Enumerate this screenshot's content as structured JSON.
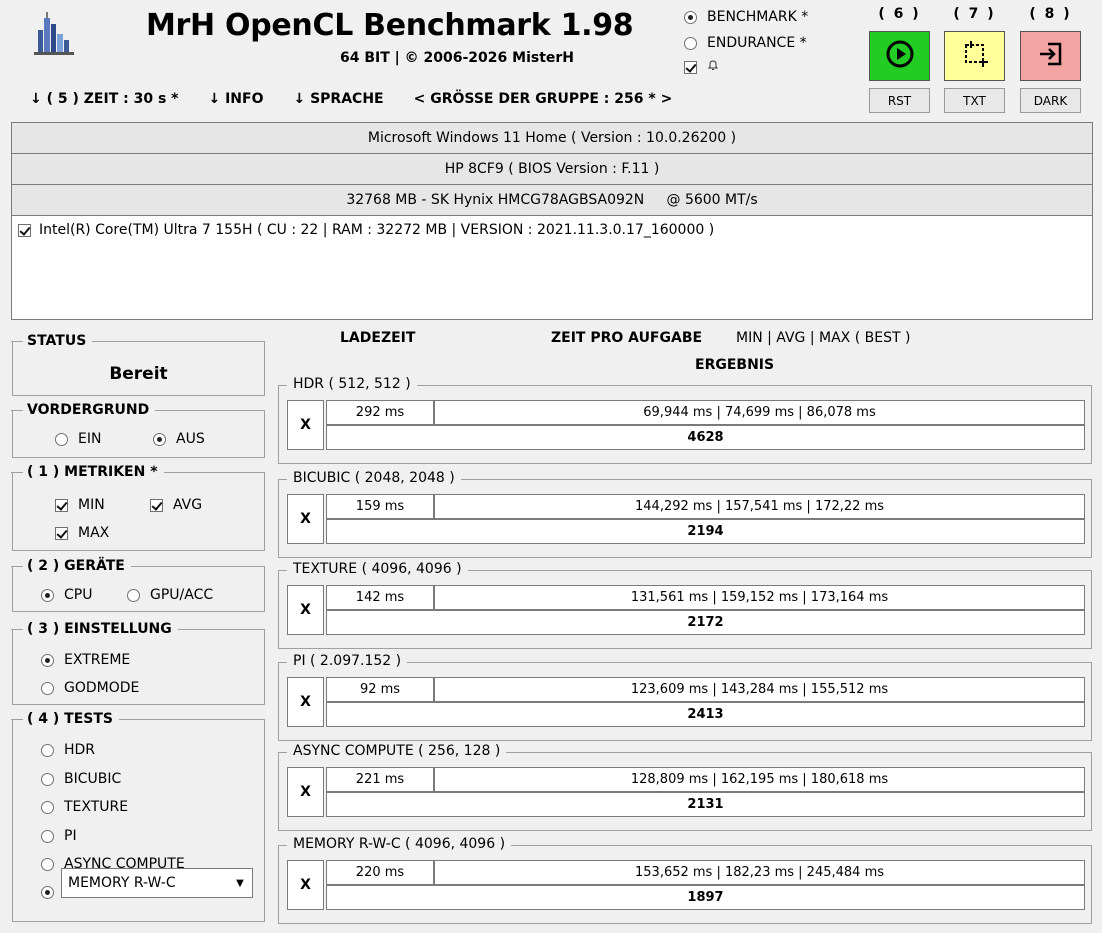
{
  "header": {
    "title": "MrH OpenCL Benchmark 1.98",
    "subtitle": "64 BIT | ©  2006-2026 MisterH",
    "logo_icon": "bar-building-logo-icon"
  },
  "top_nav": {
    "zeit": "↓ ( 5 ) ZEIT : 30 s *",
    "info": "↓ INFO",
    "sprache": "↓ SPRACHE",
    "gruppe": "< GRÖSSE DER GRUPPE : 256 * >"
  },
  "mode": {
    "benchmark": "BENCHMARK *",
    "endurance": "ENDURANCE *",
    "bell_icon": "bell-icon"
  },
  "actions": {
    "start_num": "( 6 )",
    "screenshot_num": "( 7 )",
    "exit_num": "( 8 )",
    "rst": "RST",
    "txt": "TXT",
    "dark": "DARK",
    "start_color": "#22cc22",
    "screenshot_color": "#ffff99",
    "exit_color": "#f4a3a3"
  },
  "system": {
    "os": "Microsoft Windows 11 Home ( Version : 10.0.26200 )",
    "board": "HP 8CF9 ( BIOS Version : F.11 )",
    "memory": "32768 MB - SK Hynix HMCG78AGBSA092N     @ 5600 MT/s",
    "device": "Intel(R) Core(TM) Ultra 7 155H ( CU : 22 | RAM : 32272 MB | VERSION : 2021.11.3.0.17_160000 )"
  },
  "status": {
    "title": "STATUS",
    "value": "Bereit"
  },
  "vordergrund": {
    "title": "VORDERGRUND",
    "ein": "EIN",
    "aus": "AUS"
  },
  "metriken": {
    "title": "( 1 ) METRIKEN *",
    "min": "MIN",
    "avg": "AVG",
    "max": "MAX"
  },
  "geraete": {
    "title": "( 2 ) GERÄTE",
    "cpu": "CPU",
    "gpu": "GPU/ACC"
  },
  "einstellung": {
    "title": "( 3 ) EINSTELLUNG",
    "extreme": "EXTREME",
    "godmode": "GODMODE"
  },
  "tests": {
    "title": "( 4 ) TESTS",
    "hdr": "HDR",
    "bicubic": "BICUBIC",
    "texture": "TEXTURE",
    "pi": "PI",
    "async": "ASYNC COMPUTE",
    "selected": "MEMORY R-W-C"
  },
  "columns": {
    "ladezeit": "LADEZEIT",
    "zeit_pro_aufgabe": "ZEIT PRO AUFGABE",
    "minavgmax": "MIN | AVG | MAX ( BEST )",
    "ergebnis": "ERGEBNIS"
  },
  "results": [
    {
      "name": "HDR ( 512, 512 )",
      "x": "X",
      "load": "292 ms",
      "times": "69,944 ms | 74,699 ms | 86,078 ms",
      "score": "4628"
    },
    {
      "name": "BICUBIC ( 2048, 2048 )",
      "x": "X",
      "load": "159 ms",
      "times": "144,292 ms | 157,541 ms | 172,22 ms",
      "score": "2194"
    },
    {
      "name": "TEXTURE ( 4096, 4096 )",
      "x": "X",
      "load": "142 ms",
      "times": "131,561 ms | 159,152 ms | 173,164 ms",
      "score": "2172"
    },
    {
      "name": "PI ( 2.097.152 )",
      "x": "X",
      "load": "92 ms",
      "times": "123,609 ms | 143,284 ms | 155,512 ms",
      "score": "2413"
    },
    {
      "name": "ASYNC COMPUTE ( 256, 128 )",
      "x": "X",
      "load": "221 ms",
      "times": "128,809 ms | 162,195 ms | 180,618 ms",
      "score": "2131"
    },
    {
      "name": "MEMORY R-W-C ( 4096, 4096 )",
      "x": "X",
      "load": "220 ms",
      "times": "153,652 ms | 182,23 ms | 245,484 ms",
      "score": "1897"
    }
  ]
}
